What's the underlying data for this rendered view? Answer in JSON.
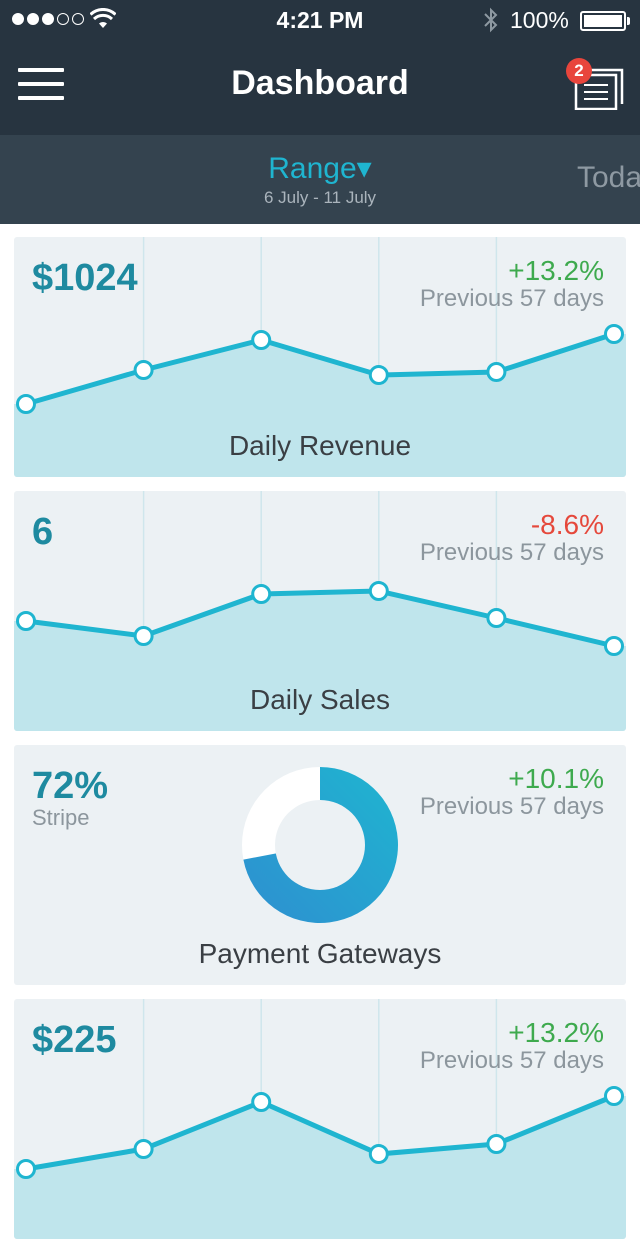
{
  "status_bar": {
    "time": "4:21 PM",
    "battery": "100%"
  },
  "nav": {
    "title": "Dashboard",
    "badge_count": "2"
  },
  "range_bar": {
    "label": "Range▾",
    "dates": "6 July - 11 July",
    "next_tab": "Today"
  },
  "colors": {
    "accent": "#1fb5d0",
    "positive": "#3eaa4e",
    "negative": "#e5483b",
    "header": "#273440"
  },
  "cards": [
    {
      "value": "$1024",
      "change": "+13.2%",
      "change_dir": "positive",
      "period": "Previous 57 days",
      "title": "Daily Revenue"
    },
    {
      "value": "6",
      "change": "-8.6%",
      "change_dir": "negative",
      "period": "Previous 57 days",
      "title": "Daily Sales"
    },
    {
      "value": "72%",
      "value_label": "Stripe",
      "change": "+10.1%",
      "change_dir": "positive",
      "period": "Previous 57 days",
      "title": "Payment Gateways"
    },
    {
      "value": "$225",
      "change": "+13.2%",
      "change_dir": "positive",
      "period": "Previous 57 days"
    }
  ],
  "chart_data": [
    {
      "type": "area",
      "series": [
        {
          "values": [
            0.18,
            0.52,
            0.82,
            0.47,
            0.5,
            0.88
          ]
        }
      ],
      "ylim": [
        0,
        1
      ]
    },
    {
      "type": "area",
      "series": [
        {
          "values": [
            0.55,
            0.4,
            0.82,
            0.85,
            0.58,
            0.3
          ]
        }
      ],
      "ylim": [
        0,
        1
      ]
    },
    {
      "type": "pie",
      "categories": [
        "Stripe",
        "Other"
      ],
      "values": [
        72,
        28
      ]
    },
    {
      "type": "area",
      "series": [
        {
          "values": [
            0.15,
            0.35,
            0.82,
            0.3,
            0.4,
            0.88
          ]
        }
      ],
      "ylim": [
        0,
        1
      ]
    }
  ]
}
